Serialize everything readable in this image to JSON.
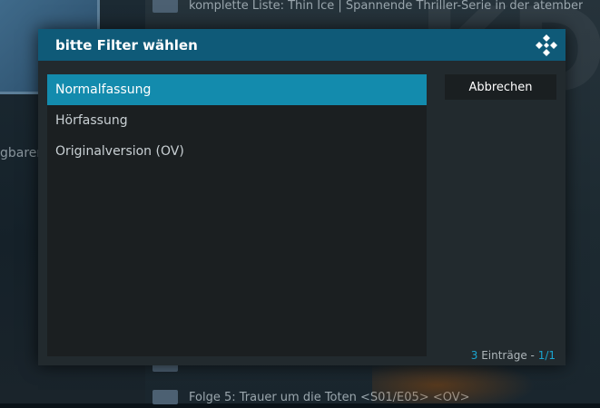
{
  "background": {
    "side_text": "gbaren",
    "list_rows": [
      {
        "text": "komplette Liste: Thin Ice | Spannende Thriller-Serie in der atember"
      },
      {
        "text": ""
      },
      {
        "text": "Folge 5: Trauer um die Toten <S01/E05> <OV>"
      }
    ],
    "watermark": "KD"
  },
  "dialog": {
    "title": "bitte Filter wählen",
    "items": [
      {
        "label": "Normalfassung",
        "selected": true
      },
      {
        "label": "Hörfassung",
        "selected": false
      },
      {
        "label": "Originalversion (OV)",
        "selected": false
      }
    ],
    "cancel_label": "Abbrechen",
    "footer": {
      "count": "3",
      "count_label": "Einträge -",
      "page": "1/1"
    }
  },
  "colors": {
    "header": "#0f5a78",
    "selected": "#138bad",
    "accent": "#1aa5d0"
  },
  "icons": {
    "logo": "kodi-logo-icon"
  }
}
